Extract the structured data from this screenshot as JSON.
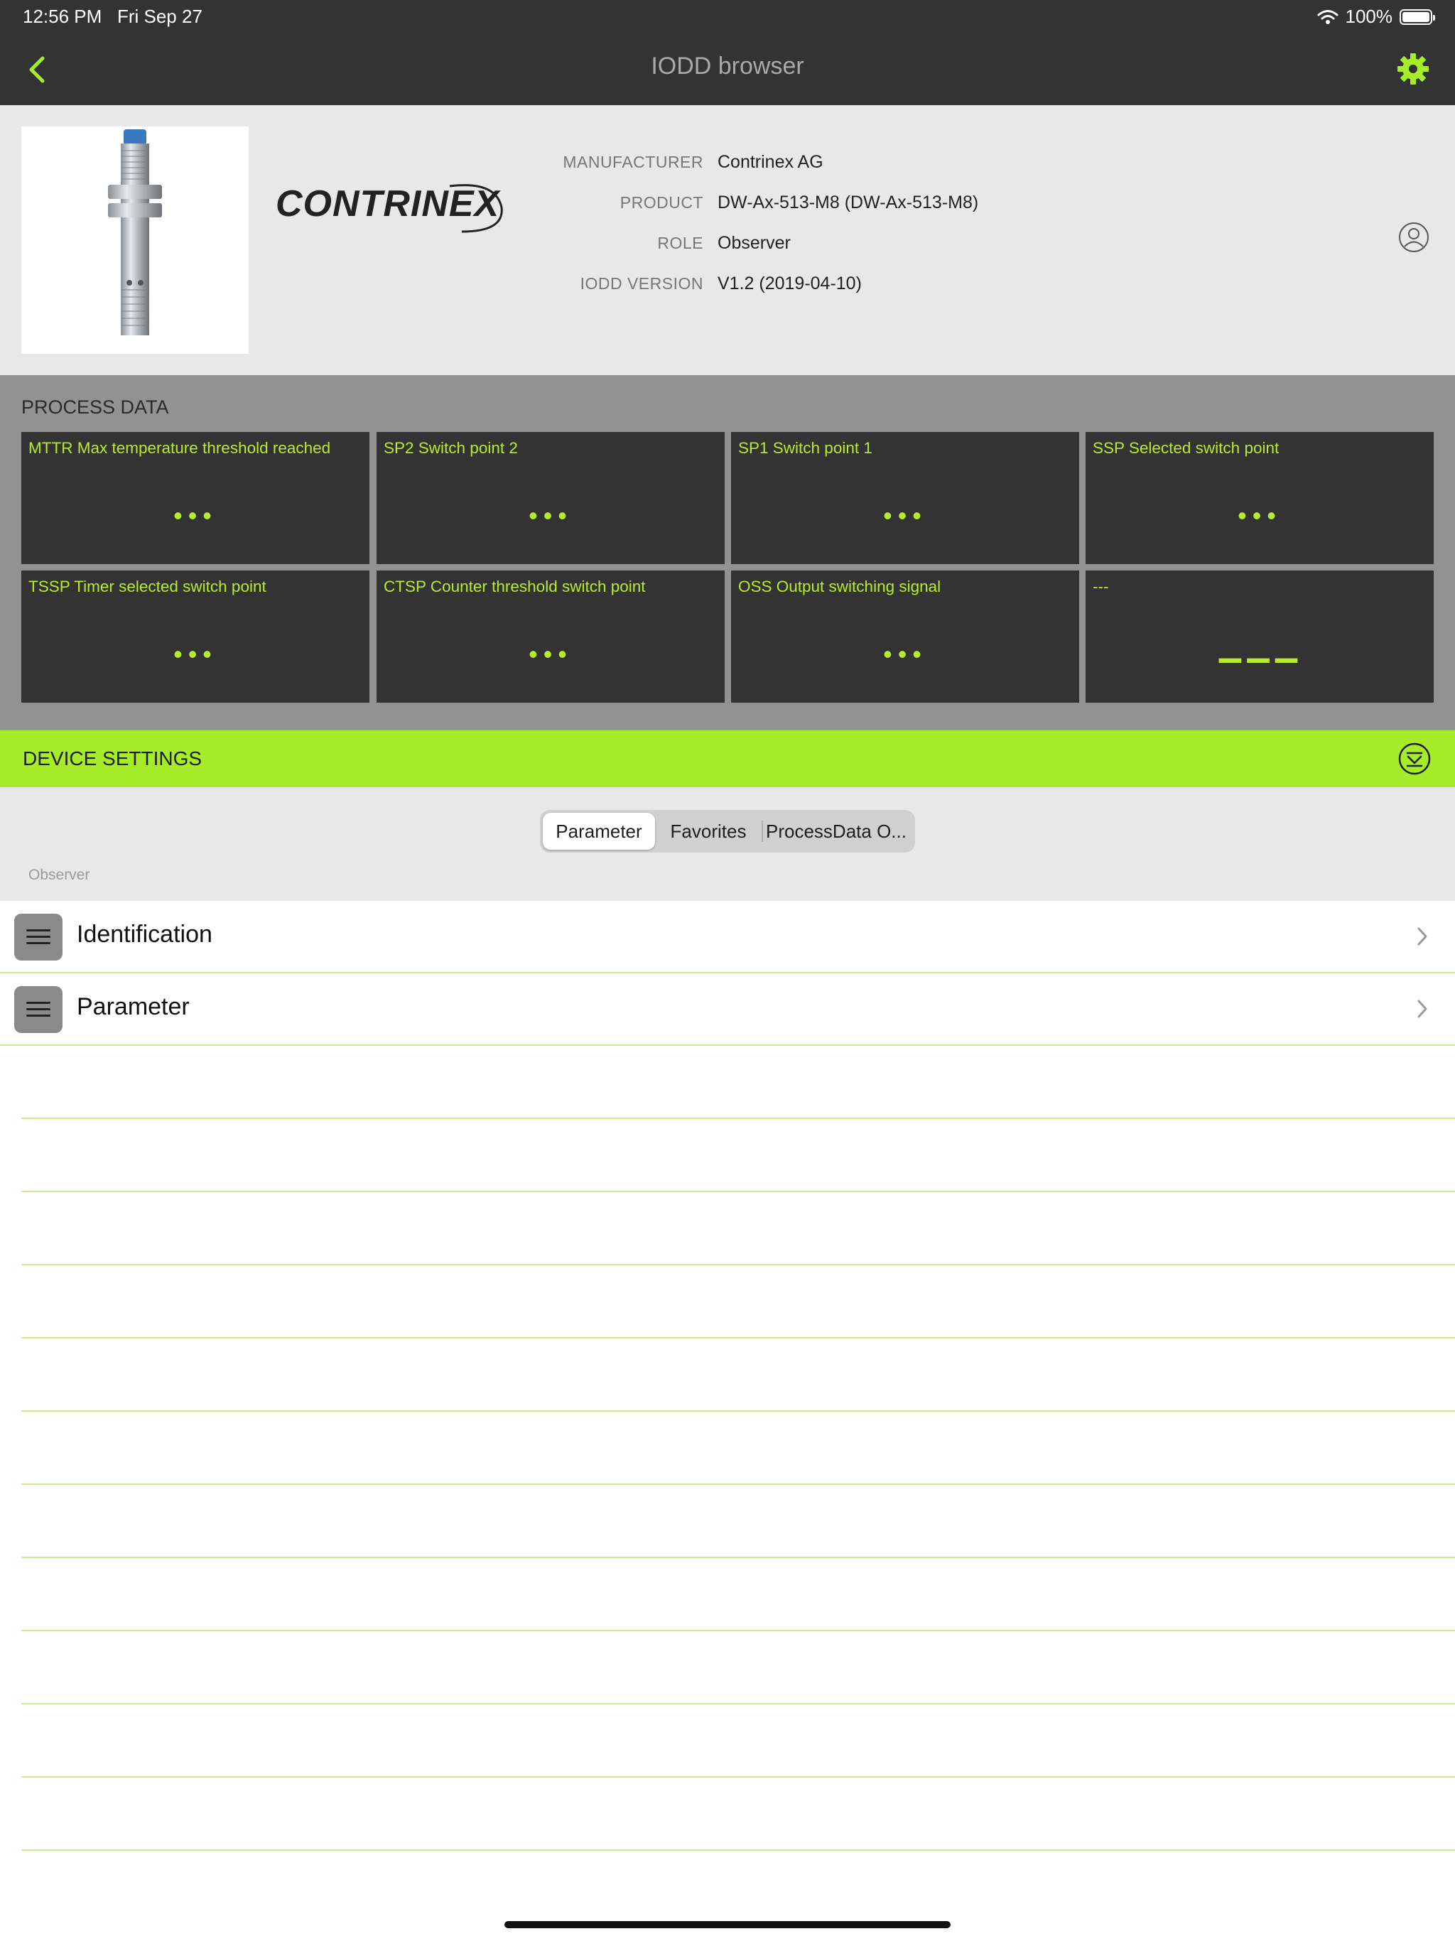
{
  "status_bar": {
    "time": "12:56 PM",
    "date": "Fri Sep 27",
    "battery": "100%"
  },
  "nav": {
    "title": "IODD browser",
    "back_icon": "chevron-left-icon",
    "settings_icon": "gear-icon"
  },
  "device": {
    "logo_text": "CONTRINEX",
    "fields": [
      {
        "key": "MANUFACTURER",
        "value": "Contrinex AG"
      },
      {
        "key": "PRODUCT",
        "value": "DW-Ax-513-M8 (DW-Ax-513-M8)"
      },
      {
        "key": "ROLE",
        "value": "Observer"
      },
      {
        "key": "IODD VERSION",
        "value": "V1.2 (2019-04-10)"
      }
    ]
  },
  "process_data": {
    "title": "PROCESS DATA",
    "tiles": [
      {
        "label": "MTTR Max temperature threshold reached",
        "value": "•••"
      },
      {
        "label": "SP2 Switch point 2",
        "value": "•••"
      },
      {
        "label": "SP1 Switch point 1",
        "value": "•••"
      },
      {
        "label": "SSP Selected switch point",
        "value": "•••"
      },
      {
        "label": "TSSP Timer selected switch point",
        "value": "•••"
      },
      {
        "label": "CTSP Counter threshold switch point",
        "value": "•••"
      },
      {
        "label": "OSS Output switching signal",
        "value": "•••"
      },
      {
        "label": "---",
        "value": "–––"
      }
    ]
  },
  "device_settings": {
    "title": "DEVICE SETTINGS",
    "tabs": [
      {
        "label": "Parameter",
        "active": true
      },
      {
        "label": "Favorites",
        "active": false
      },
      {
        "label": "ProcessData O...",
        "active": false
      }
    ],
    "role_caption": "Observer",
    "list": [
      {
        "label": "Identification"
      },
      {
        "label": "Parameter"
      }
    ]
  },
  "colors": {
    "accent": "#a6ec29",
    "tile_text": "#b6ec2d",
    "bar": "#333333",
    "process_bg": "#929292"
  }
}
